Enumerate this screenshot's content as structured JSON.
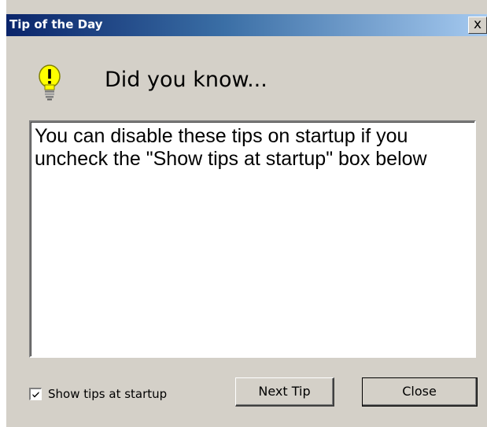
{
  "window": {
    "title": "Tip of the Day",
    "close_glyph": "x"
  },
  "header": {
    "icon": "lightbulb-icon",
    "heading": "Did you know..."
  },
  "tip": {
    "text": "You can disable these tips on startup if you uncheck the \"Show tips at startup\" box below"
  },
  "footer": {
    "show_tips_label": "Show tips at startup",
    "show_tips_checked": true,
    "next_tip_label": "Next Tip",
    "close_label": "Close"
  },
  "colors": {
    "dialog_face": "#d4d0c8",
    "titlebar_start": "#0a246a",
    "titlebar_end": "#a6caf0",
    "bulb_yellow": "#ffff00"
  }
}
